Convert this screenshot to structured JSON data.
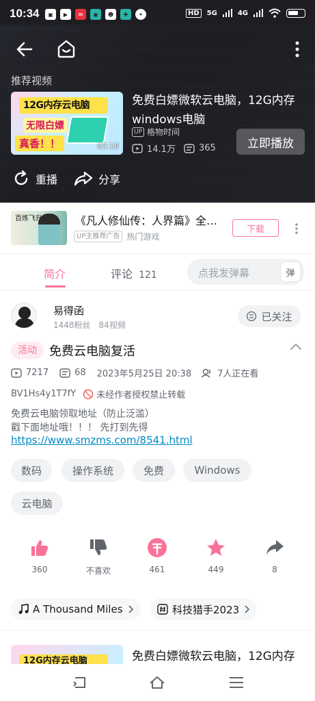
{
  "status_bar": {
    "time": "10:34",
    "network_label": "HD",
    "signal_1": "5G",
    "signal_2": "4G"
  },
  "player": {
    "recommend_heading": "推荐视频",
    "recommended": {
      "thumb_banner": "12G内存云电脑",
      "thumb_line2": "无限白嫖",
      "thumb_line3": "真香！！",
      "duration": "02:18",
      "title": "免费白嫖微软云电脑，12G内存windows电脑",
      "up_badge": "UP",
      "up_name": "格物时间",
      "views": "14.1万",
      "danmaku": "365"
    },
    "play_now": "立即播放",
    "replay": "重播",
    "share": "分享"
  },
  "ad": {
    "title": "《凡人修仙传：人界篇》全…",
    "tag": "UP主推荐广告",
    "category": "热门游戏",
    "download": "下载",
    "thumb_text": "百炼飞升"
  },
  "tabs": {
    "intro": "简介",
    "comments_label": "评论",
    "comments_count": "121",
    "danmaku_placeholder": "点我发弹幕",
    "danmaku_btn": "弹"
  },
  "uploader": {
    "name": "易得函",
    "fans": "1448粉丝",
    "videos": "84视频",
    "follow": "已关注"
  },
  "video": {
    "activity_badge": "活动",
    "title": "免费云电脑复活",
    "plays": "7217",
    "danmaku": "68",
    "date": "2023年5月25日 20:38",
    "watching": "7人正在看",
    "bvid": "BV1Hs4y1T7fY",
    "copyright": "未经作者授权禁止转载",
    "desc_line1": "免费云电脑领取地址（防止泛滥）",
    "desc_line2": "戳下面地址哦！！！ 先打到先得",
    "link": "https://www.smzms.com/8541.html"
  },
  "tags": [
    "数码",
    "操作系统",
    "免费",
    "Windows",
    "云电脑"
  ],
  "actions": {
    "like": "360",
    "dislike": "不喜欢",
    "coin": "461",
    "favorite": "449",
    "share": "8"
  },
  "pill_tags": {
    "music": "A Thousand Miles",
    "topic": "科技猎手2023"
  },
  "related": {
    "thumb_banner": "12G内存云电脑",
    "title": "免费白嫖微软云电脑，12G内存"
  },
  "colors": {
    "accent_pink": "#fb7299",
    "link_blue": "#008ac5",
    "text_primary": "#18191c",
    "text_secondary": "#61666d"
  }
}
